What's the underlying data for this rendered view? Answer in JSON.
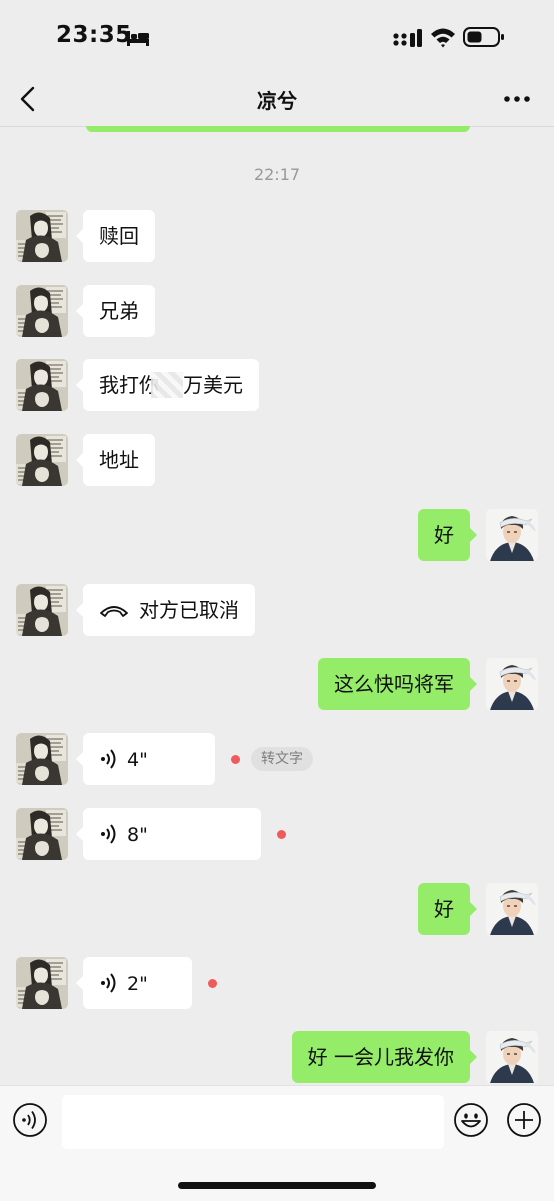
{
  "status_bar": {
    "time": "23:35"
  },
  "header": {
    "title": "凉兮"
  },
  "timestamp": "22:17",
  "messages": [
    {
      "side": "in",
      "type": "text",
      "text": "赎回"
    },
    {
      "side": "in",
      "type": "text",
      "text": "兄弟"
    },
    {
      "side": "in",
      "type": "text",
      "text_before": "我打你",
      "text_after": "万美元",
      "redacted": true
    },
    {
      "side": "in",
      "type": "text",
      "text": "地址"
    },
    {
      "side": "out",
      "type": "text",
      "text": "好"
    },
    {
      "side": "in",
      "type": "call",
      "text": "对方已取消"
    },
    {
      "side": "out",
      "type": "text",
      "text": "这么快吗将军"
    },
    {
      "side": "in",
      "type": "voice",
      "duration": "4\"",
      "unread": true,
      "action": "转文字"
    },
    {
      "side": "in",
      "type": "voice",
      "duration": "8\"",
      "unread": true
    },
    {
      "side": "out",
      "type": "text",
      "text": "好"
    },
    {
      "side": "in",
      "type": "voice",
      "duration": "2\"",
      "unread": true
    },
    {
      "side": "out",
      "type": "text",
      "text": "好 一会儿我发你"
    }
  ],
  "input": {
    "placeholder": ""
  },
  "colors": {
    "self_bubble": "#95ec69",
    "other_bubble": "#ffffff",
    "background": "#ededed",
    "unread_dot": "#f05a5a"
  }
}
